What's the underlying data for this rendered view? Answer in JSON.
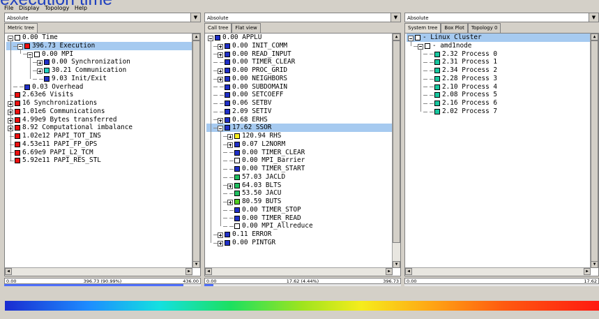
{
  "slide_title_fragment": "execution time",
  "menu": [
    "File",
    "Display",
    "Topology",
    "Help"
  ],
  "colors": {
    "selection": "#a6caf0",
    "white": "#ffffff",
    "blue": "#1a2cd0",
    "cyan": "#20d0c0",
    "green": "#20c060",
    "lime": "#50d020",
    "yellow": "#f8f020",
    "red": "#ee1010",
    "dblue": "#2030c8",
    "teal": "#18c8a0"
  },
  "panels": [
    {
      "combo_value": "Absolute",
      "tabs": [
        "Metric tree"
      ],
      "status": {
        "left": "0.00",
        "center": "396.73 (90.99%)",
        "right": "436.00"
      },
      "gauge_fraction": 0.9099,
      "rows": [
        {
          "depth": 0,
          "expander": "minus",
          "color": "white",
          "text": "0.00 Time",
          "sel": false,
          "last": false
        },
        {
          "depth": 1,
          "expander": "minus",
          "color": "red",
          "text": "396.73 Execution",
          "sel": true,
          "last": false
        },
        {
          "depth": 2,
          "expander": "minus",
          "color": "white",
          "text": "0.00 MPI",
          "sel": false,
          "last": false
        },
        {
          "depth": 3,
          "expander": "plus",
          "color": "dblue",
          "text": "0.00 Synchronization",
          "sel": false,
          "last": false
        },
        {
          "depth": 3,
          "expander": "plus",
          "color": "cyan",
          "text": "30.21 Communication",
          "sel": false,
          "last": false
        },
        {
          "depth": 3,
          "expander": "none",
          "color": "dblue",
          "text": "9.03 Init/Exit",
          "sel": false,
          "last": true
        },
        {
          "depth": 1,
          "expander": "none",
          "color": "dblue",
          "text": "0.03 Overhead",
          "sel": false,
          "last": true
        },
        {
          "depth": 0,
          "expander": "none",
          "color": "red",
          "text": "2.63e6 Visits",
          "sel": false,
          "last": false
        },
        {
          "depth": 0,
          "expander": "plus",
          "color": "red",
          "text": "16 Synchronizations",
          "sel": false,
          "last": false
        },
        {
          "depth": 0,
          "expander": "plus",
          "color": "red",
          "text": "1.01e6 Communications",
          "sel": false,
          "last": false
        },
        {
          "depth": 0,
          "expander": "plus",
          "color": "red",
          "text": "4.99e9 Bytes transferred",
          "sel": false,
          "last": false
        },
        {
          "depth": 0,
          "expander": "plus",
          "color": "red",
          "text": "8.92 Computational imbalance",
          "sel": false,
          "last": false
        },
        {
          "depth": 0,
          "expander": "none",
          "color": "red",
          "text": "1.02e12 PAPI_TOT_INS",
          "sel": false,
          "last": false
        },
        {
          "depth": 0,
          "expander": "none",
          "color": "red",
          "text": "4.53e11 PAPI_FP_OPS",
          "sel": false,
          "last": false
        },
        {
          "depth": 0,
          "expander": "none",
          "color": "red",
          "text": "6.69e9 PAPI_L2_TCM",
          "sel": false,
          "last": false
        },
        {
          "depth": 0,
          "expander": "none",
          "color": "red",
          "text": "5.92e11 PAPI_RES_STL",
          "sel": false,
          "last": true
        }
      ]
    },
    {
      "combo_value": "Absolute",
      "tabs": [
        "Call tree",
        "Flat view"
      ],
      "status": {
        "left": "0.00",
        "center": "17.62 (4.44%)",
        "right": "396.73"
      },
      "gauge_fraction": 0.0444,
      "rows": [
        {
          "depth": 0,
          "expander": "minus",
          "color": "dblue",
          "text": "0.00 APPLU",
          "sel": false,
          "last": false
        },
        {
          "depth": 1,
          "expander": "plus",
          "color": "dblue",
          "text": "0.00 INIT_COMM",
          "sel": false,
          "last": false
        },
        {
          "depth": 1,
          "expander": "plus",
          "color": "dblue",
          "text": "0.00 READ_INPUT",
          "sel": false,
          "last": false
        },
        {
          "depth": 1,
          "expander": "none",
          "color": "dblue",
          "text": "0.00 TIMER_CLEAR",
          "sel": false,
          "last": false
        },
        {
          "depth": 1,
          "expander": "plus",
          "color": "dblue",
          "text": "0.00 PROC_GRID",
          "sel": false,
          "last": false
        },
        {
          "depth": 1,
          "expander": "plus",
          "color": "dblue",
          "text": "0.00 NEIGHBORS",
          "sel": false,
          "last": false
        },
        {
          "depth": 1,
          "expander": "none",
          "color": "dblue",
          "text": "0.00 SUBDOMAIN",
          "sel": false,
          "last": false
        },
        {
          "depth": 1,
          "expander": "none",
          "color": "dblue",
          "text": "0.00 SETCOEFF",
          "sel": false,
          "last": false
        },
        {
          "depth": 1,
          "expander": "none",
          "color": "dblue",
          "text": "0.06 SETBV",
          "sel": false,
          "last": false
        },
        {
          "depth": 1,
          "expander": "none",
          "color": "dblue",
          "text": "2.09 SETIV",
          "sel": false,
          "last": false
        },
        {
          "depth": 1,
          "expander": "plus",
          "color": "dblue",
          "text": "0.68 ERHS",
          "sel": false,
          "last": false
        },
        {
          "depth": 1,
          "expander": "minus",
          "color": "dblue",
          "text": "17.62 SSOR",
          "sel": true,
          "last": false
        },
        {
          "depth": 2,
          "expander": "plus",
          "color": "yellow",
          "text": "120.94 RHS",
          "sel": false,
          "last": false
        },
        {
          "depth": 2,
          "expander": "plus",
          "color": "dblue",
          "text": "0.07 L2NORM",
          "sel": false,
          "last": false
        },
        {
          "depth": 2,
          "expander": "none",
          "color": "dblue",
          "text": "0.00 TIMER_CLEAR",
          "sel": false,
          "last": false
        },
        {
          "depth": 2,
          "expander": "none",
          "color": "white",
          "text": "0.00 MPI_Barrier",
          "sel": false,
          "last": false
        },
        {
          "depth": 2,
          "expander": "none",
          "color": "dblue",
          "text": "0.00 TIMER_START",
          "sel": false,
          "last": false
        },
        {
          "depth": 2,
          "expander": "none",
          "color": "green",
          "text": "57.03 JACLD",
          "sel": false,
          "last": false
        },
        {
          "depth": 2,
          "expander": "plus",
          "color": "green",
          "text": "64.03 BLTS",
          "sel": false,
          "last": false
        },
        {
          "depth": 2,
          "expander": "none",
          "color": "green",
          "text": "53.50 JACU",
          "sel": false,
          "last": false
        },
        {
          "depth": 2,
          "expander": "plus",
          "color": "lime",
          "text": "80.59 BUTS",
          "sel": false,
          "last": false
        },
        {
          "depth": 2,
          "expander": "none",
          "color": "dblue",
          "text": "0.00 TIMER_STOP",
          "sel": false,
          "last": false
        },
        {
          "depth": 2,
          "expander": "none",
          "color": "dblue",
          "text": "0.00 TIMER_READ",
          "sel": false,
          "last": false
        },
        {
          "depth": 2,
          "expander": "none",
          "color": "white",
          "text": "0.00 MPI_Allreduce",
          "sel": false,
          "last": true
        },
        {
          "depth": 1,
          "expander": "plus",
          "color": "dblue",
          "text": "0.11 ERROR",
          "sel": false,
          "last": false
        },
        {
          "depth": 1,
          "expander": "plus",
          "color": "dblue",
          "text": "0.00 PINTGR",
          "sel": false,
          "last": false
        }
      ]
    },
    {
      "combo_value": "Absolute",
      "tabs": [
        "System tree",
        "Box Plot",
        "Topology 0"
      ],
      "status": {
        "left": "0.00",
        "center": "",
        "right": "17.62"
      },
      "gauge_fraction": 0,
      "rows": [
        {
          "depth": 0,
          "expander": "minus",
          "color": "white",
          "text": "- Linux Cluster",
          "sel": true,
          "last": false
        },
        {
          "depth": 1,
          "expander": "minus",
          "color": "white",
          "text": "- amd1node",
          "sel": false,
          "last": true
        },
        {
          "depth": 2,
          "expander": "none",
          "color": "teal",
          "text": "2.32 Process 0",
          "sel": false,
          "last": false
        },
        {
          "depth": 2,
          "expander": "none",
          "color": "teal",
          "text": "2.31 Process 1",
          "sel": false,
          "last": false
        },
        {
          "depth": 2,
          "expander": "none",
          "color": "teal",
          "text": "2.34 Process 2",
          "sel": false,
          "last": false
        },
        {
          "depth": 2,
          "expander": "none",
          "color": "teal",
          "text": "2.28 Process 3",
          "sel": false,
          "last": false
        },
        {
          "depth": 2,
          "expander": "none",
          "color": "teal",
          "text": "2.10 Process 4",
          "sel": false,
          "last": false
        },
        {
          "depth": 2,
          "expander": "none",
          "color": "teal",
          "text": "2.08 Process 5",
          "sel": false,
          "last": false
        },
        {
          "depth": 2,
          "expander": "none",
          "color": "teal",
          "text": "2.16 Process 6",
          "sel": false,
          "last": false
        },
        {
          "depth": 2,
          "expander": "none",
          "color": "teal",
          "text": "2.02 Process 7",
          "sel": false,
          "last": true
        }
      ]
    }
  ]
}
